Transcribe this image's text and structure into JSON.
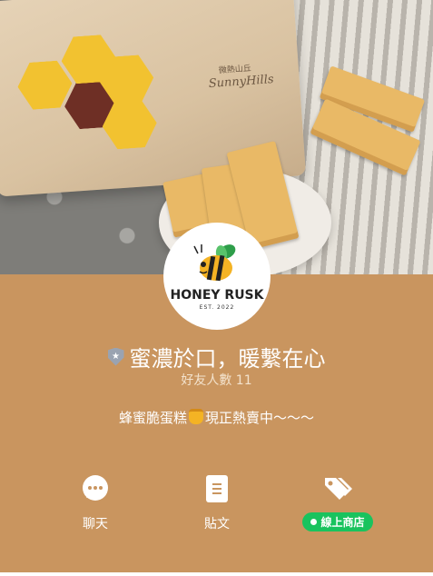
{
  "cover": {
    "bag_text": "SunnyHills",
    "bag_text_cn": "微熱山丘"
  },
  "logo": {
    "name": "HONEY RUSK",
    "est": "EST. 2022"
  },
  "profile": {
    "title": "蜜濃於口，暖繫在心",
    "friends": "好友人數 11",
    "status_before": "蜂蜜脆蛋糕",
    "status_after": "現正熱賣中～～～"
  },
  "actions": {
    "chat": "聊天",
    "posts": "貼文",
    "shop": "線上商店"
  },
  "colors": {
    "background": "#c9955f",
    "shop_green": "#19c35e"
  }
}
